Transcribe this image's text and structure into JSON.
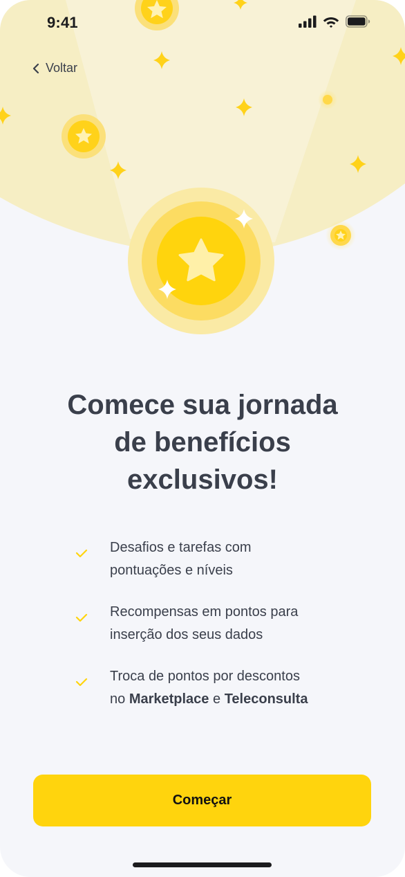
{
  "status_bar": {
    "time": "9:41"
  },
  "nav": {
    "back_label": "Voltar"
  },
  "hero": {
    "illustration": "coins-with-stars"
  },
  "headline": {
    "lines": [
      "Comece sua jornada",
      "de benefícios",
      "exclusivos!"
    ]
  },
  "features": [
    {
      "line1": "Desafios e tarefas com",
      "line2": "pontuações e níveis"
    },
    {
      "line1": "Recompensas em pontos para",
      "line2": "inserção dos seus dados"
    },
    {
      "line1": "Troca de pontos por descontos",
      "line2_prefix": "no ",
      "line2_bold1": "Marketplace",
      "line2_mid": " e ",
      "line2_bold2": "Teleconsulta"
    }
  ],
  "cta": {
    "label": "Começar"
  },
  "colors": {
    "accent": "#FFD40D",
    "background": "#F5F6FA",
    "hero_bg": "#F6EEC4",
    "text": "#3A3F4B"
  },
  "icons": [
    "signal-icon",
    "wifi-icon",
    "battery-icon",
    "chevron-left-icon",
    "check-icon",
    "star-icon",
    "sparkle-icon",
    "coin-icon"
  ]
}
